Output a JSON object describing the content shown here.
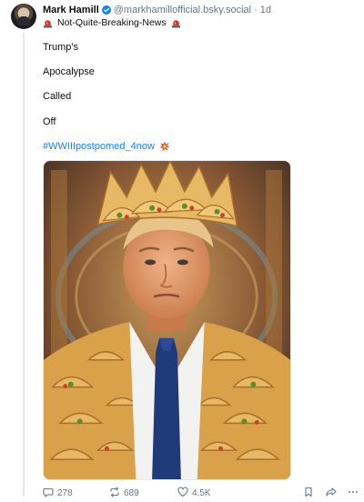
{
  "post": {
    "author_name": "Mark Hamill",
    "handle": "@markhamillofficial.bsky.social",
    "separator": "·",
    "age": "1d",
    "subline": "Not-Quite-Breaking-News",
    "lines": [
      "Trump's",
      "Apocalypse",
      "Called",
      "Off"
    ],
    "hashtag": "#WWIIIpostpomed_4now",
    "icons": {
      "verified": "verified-check-icon",
      "siren": "siren-icon",
      "collision": "collision-icon"
    }
  },
  "actions": {
    "replies": "278",
    "reposts": "689",
    "likes": "4.5K"
  },
  "colors": {
    "link": "#1083fe",
    "muted": "#66788a",
    "verified": "#1083fe",
    "siren": "#e0302b"
  }
}
